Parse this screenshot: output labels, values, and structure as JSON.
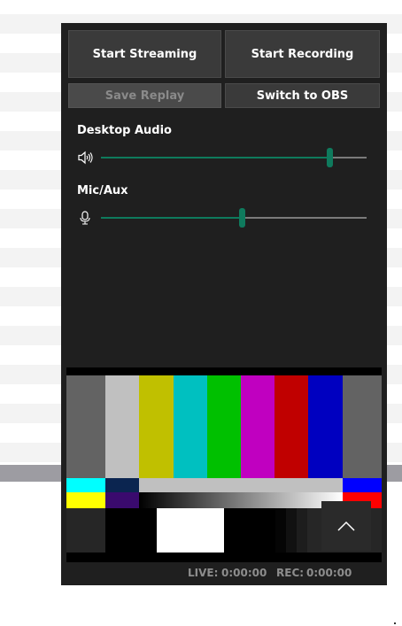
{
  "buttons": {
    "start_streaming": "Start Streaming",
    "start_recording": "Start Recording",
    "save_replay": "Save Replay",
    "switch_to_obs": "Switch to OBS"
  },
  "audio": {
    "desktop": {
      "label": "Desktop Audio",
      "level": 0.86,
      "icon": "speaker-icon"
    },
    "mic": {
      "label": "Mic/Aux",
      "level": 0.53,
      "icon": "microphone-icon"
    }
  },
  "status": {
    "live_label": "LIVE:",
    "live_time": "0:00:00",
    "rec_label": "REC:",
    "rec_time": "0:00:00"
  },
  "colors": {
    "panel": "#1f1f1f",
    "accent": "#0f7a5d"
  },
  "preview": {
    "pattern": "smpte-color-bars"
  }
}
